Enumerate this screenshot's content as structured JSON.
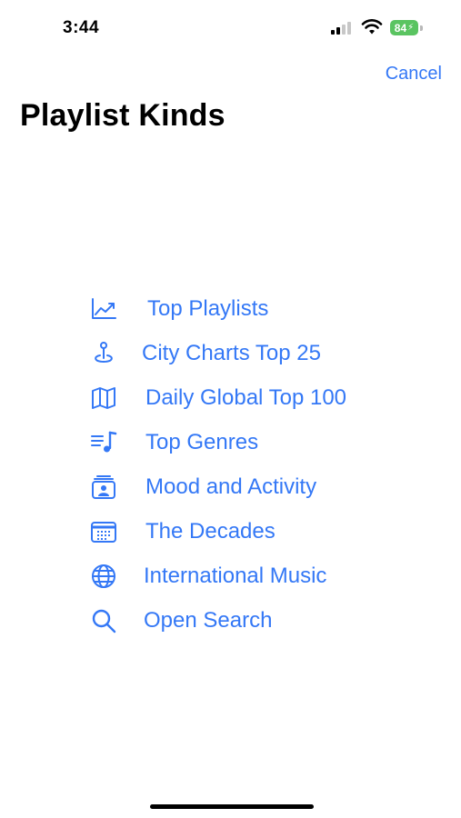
{
  "status_bar": {
    "time": "3:44",
    "battery_level": "84",
    "battery_color": "#5ac461"
  },
  "nav": {
    "cancel_label": "Cancel"
  },
  "title": "Playlist Kinds",
  "accent_color": "#3478f6",
  "menu": [
    {
      "label": "Top Playlists",
      "icon": "chart-line-icon"
    },
    {
      "label": "City Charts Top 25",
      "icon": "location-pin-icon"
    },
    {
      "label": "Daily Global Top 100",
      "icon": "map-icon"
    },
    {
      "label": "Top Genres",
      "icon": "music-list-icon"
    },
    {
      "label": "Mood and Activity",
      "icon": "person-rectangle-stack-icon"
    },
    {
      "label": "The Decades",
      "icon": "calendar-icon"
    },
    {
      "label": "International Music",
      "icon": "globe-icon"
    },
    {
      "label": "Open Search",
      "icon": "search-icon"
    }
  ]
}
